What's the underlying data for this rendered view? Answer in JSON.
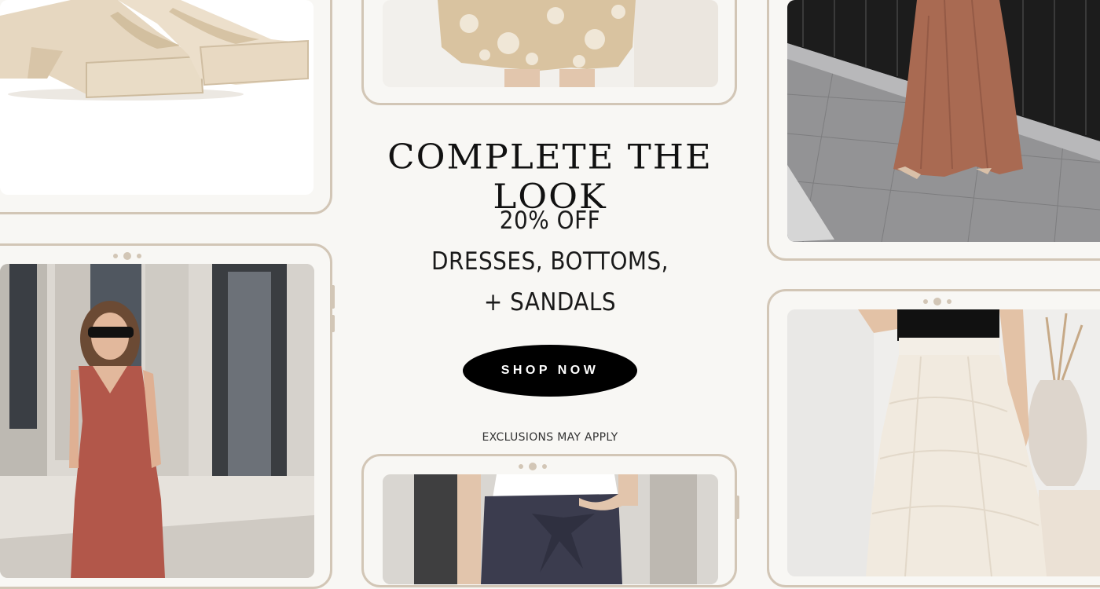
{
  "promo": {
    "headline": "COMPLETE THE LOOK",
    "offer_lines": [
      "20% OFF",
      "DRESSES, BOTTOMS,",
      "+ SANDALS"
    ],
    "cta_label": "SHOP NOW",
    "disclaimer": "EXCLUSIONS MAY APPLY"
  },
  "products": [
    {
      "name": "cream-platform-sandals"
    },
    {
      "name": "floral-dress"
    },
    {
      "name": "rust-maxi-skirt"
    },
    {
      "name": "rust-tank-dress"
    },
    {
      "name": "navy-tie-waist-pants"
    },
    {
      "name": "ivory-tulle-skirt"
    }
  ],
  "colors": {
    "background": "#f8f7f4",
    "frame": "#d2c6b6",
    "cta_background": "#000000",
    "cta_text": "#ffffff"
  }
}
